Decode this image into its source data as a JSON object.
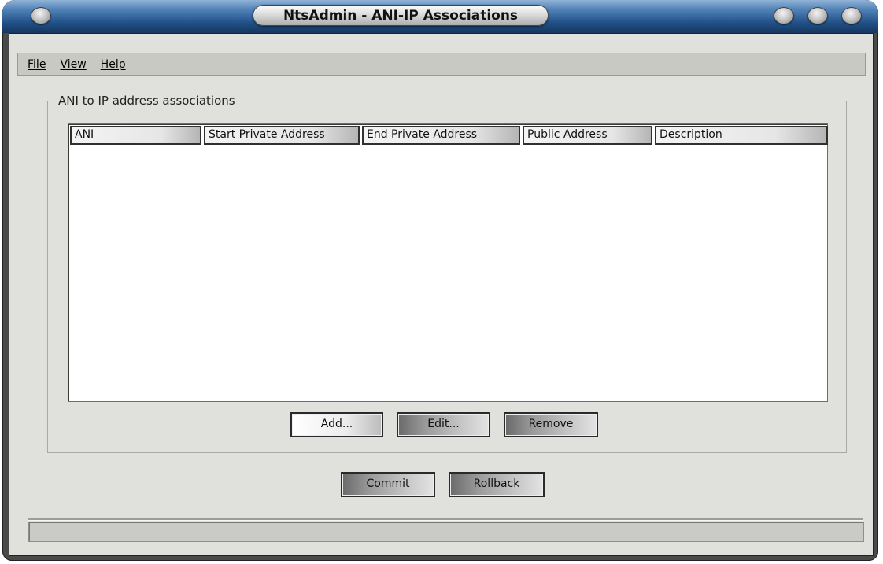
{
  "window": {
    "title": "NtsAdmin - ANI-IP Associations"
  },
  "menubar": {
    "items": [
      {
        "label": "File"
      },
      {
        "label": "View"
      },
      {
        "label": "Help"
      }
    ]
  },
  "group": {
    "legend": "ANI to IP address associations"
  },
  "table": {
    "columns": [
      "ANI",
      "Start Private Address",
      "End Private Address",
      "Public Address",
      "Description"
    ],
    "rows": []
  },
  "buttons": {
    "add": "Add...",
    "edit": "Edit...",
    "remove": "Remove",
    "commit": "Commit",
    "rollback": "Rollback"
  },
  "statusbar": {
    "text": ""
  },
  "colors": {
    "titlebar_blue": "#1f4f86",
    "client_bg": "#e0e0dc",
    "menubar_bg": "#c9c9c4",
    "frame_dark": "#4a4a4a"
  }
}
